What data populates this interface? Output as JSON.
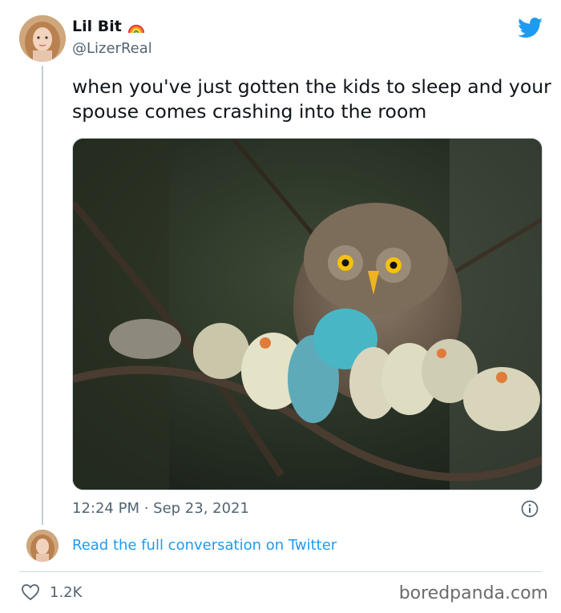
{
  "tweet": {
    "display_name": "Lil Bit",
    "handle": "@LizerReal",
    "text": "when you've just gotten the kids to sleep and your spouse comes crashing into the room",
    "timestamp": "12:24 PM · Sep 23, 2021",
    "likes": "1.2K",
    "read_more": "Read the full conversation on Twitter"
  },
  "icons": {
    "name_emoji": "rainbow-icon",
    "brand": "twitter-bird-icon",
    "info": "info-icon",
    "like": "heart-icon"
  },
  "colors": {
    "link": "#1d9bf0",
    "secondary_text": "#536471",
    "brand": "#1d9bf0"
  },
  "watermark": "boredpanda.com"
}
